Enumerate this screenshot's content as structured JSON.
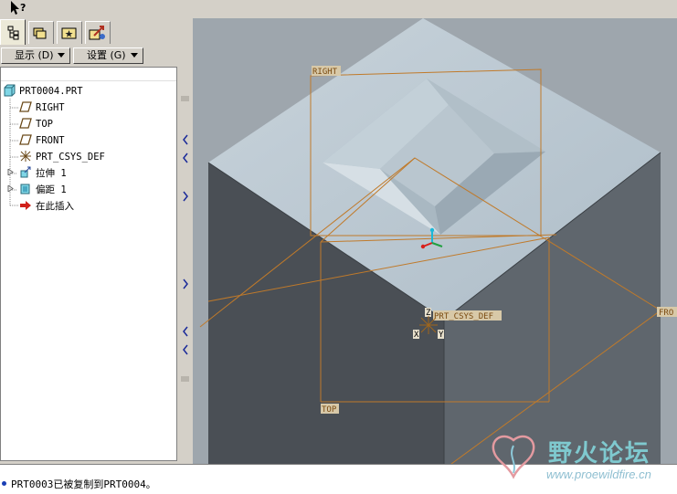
{
  "toolbar": {
    "display_label": "显示 (D)",
    "settings_label": "设置 (G)"
  },
  "tabs": [
    {
      "icon": "model-tree-icon",
      "active": true
    },
    {
      "icon": "folder-browser-icon",
      "active": false
    },
    {
      "icon": "favorites-icon",
      "active": false
    },
    {
      "icon": "connections-icon",
      "active": false
    }
  ],
  "tree": {
    "root": "PRT0004.PRT",
    "items": [
      {
        "label": "RIGHT",
        "icon": "datum-plane-icon"
      },
      {
        "label": "TOP",
        "icon": "datum-plane-icon"
      },
      {
        "label": "FRONT",
        "icon": "datum-plane-icon"
      },
      {
        "label": "PRT_CSYS_DEF",
        "icon": "csys-icon"
      },
      {
        "label": "拉伸 1",
        "icon": "extrude-icon"
      },
      {
        "label": "偏距 1",
        "icon": "offset-icon"
      },
      {
        "label": "在此插入",
        "icon": "insert-here-arrow-icon"
      }
    ]
  },
  "viewport": {
    "labels": {
      "right": "RIGHT",
      "front": "FRO",
      "top": "TOP",
      "csys": "PRT_CSYS_DEF",
      "z": "Z",
      "x": "X",
      "y": "Y"
    },
    "colors": {
      "top_face": "#b4c3cd",
      "left_face": "#4a4f55",
      "right_face": "#5f666d",
      "datum": "#c07a2a"
    }
  },
  "status": {
    "message": "PRT0003已被复制到PRT0004。"
  },
  "watermark": {
    "title": "野火论坛",
    "url": "www.proewildfire.cn"
  }
}
